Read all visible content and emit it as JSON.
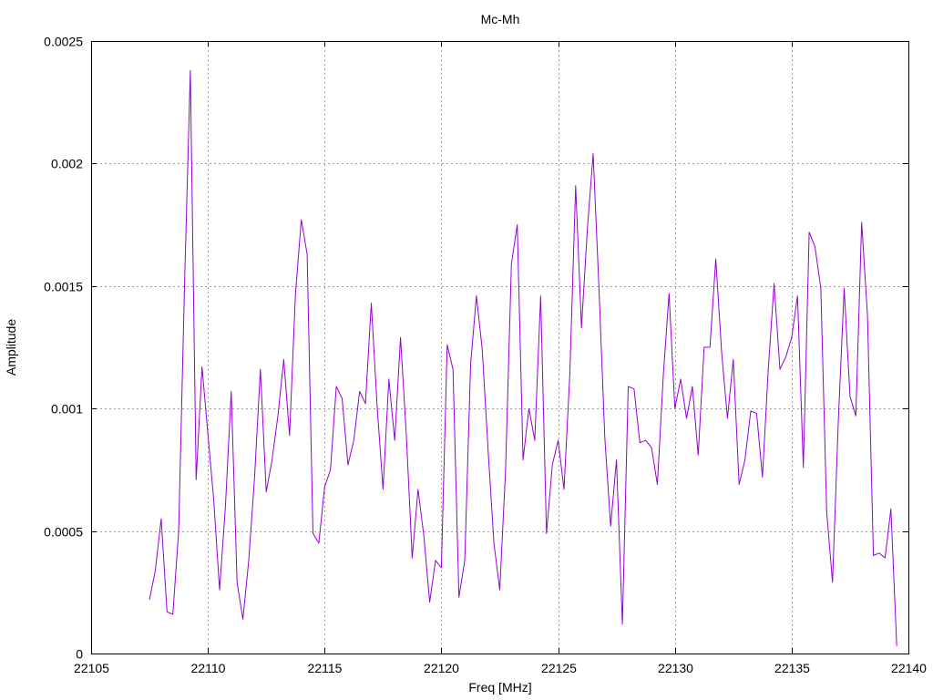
{
  "chart_data": {
    "type": "line",
    "title": "Mc-Mh",
    "xlabel": "Freq [MHz]",
    "ylabel": "Amplitude",
    "xlim": [
      22105,
      22140
    ],
    "ylim": [
      0,
      0.0025
    ],
    "xticks": [
      "22105",
      "22110",
      "22115",
      "22120",
      "22125",
      "22130",
      "22135",
      "22140"
    ],
    "yticks": [
      "0",
      "0.0005",
      "0.001",
      "0.0015",
      "0.002",
      "0.0025"
    ],
    "grid": true,
    "series": [
      {
        "color": "#9400d3",
        "x": [
          22107.5,
          22107.75,
          22108.0,
          22108.25,
          22108.5,
          22108.75,
          22109.0,
          22109.25,
          22109.5,
          22109.75,
          22110.0,
          22110.25,
          22110.5,
          22110.75,
          22111.0,
          22111.25,
          22111.5,
          22111.75,
          22112.0,
          22112.25,
          22112.5,
          22112.75,
          22113.0,
          22113.25,
          22113.5,
          22113.75,
          22114.0,
          22114.25,
          22114.5,
          22114.75,
          22115.0,
          22115.25,
          22115.5,
          22115.75,
          22116.0,
          22116.25,
          22116.5,
          22116.75,
          22117.0,
          22117.25,
          22117.5,
          22117.75,
          22118.0,
          22118.25,
          22118.5,
          22118.75,
          22119.0,
          22119.25,
          22119.5,
          22119.75,
          22120.0,
          22120.25,
          22120.5,
          22120.75,
          22121.0,
          22121.25,
          22121.5,
          22121.75,
          22122.0,
          22122.25,
          22122.5,
          22122.75,
          22123.0,
          22123.25,
          22123.5,
          22123.75,
          22124.0,
          22124.25,
          22124.5,
          22124.75,
          22125.0,
          22125.25,
          22125.5,
          22125.75,
          22126.0,
          22126.25,
          22126.5,
          22126.75,
          22127.0,
          22127.25,
          22127.5,
          22127.75,
          22128.0,
          22128.25,
          22128.5,
          22128.75,
          22129.0,
          22129.25,
          22129.5,
          22129.75,
          22130.0,
          22130.25,
          22130.5,
          22130.75,
          22131.0,
          22131.25,
          22131.5,
          22131.75,
          22132.0,
          22132.25,
          22132.5,
          22132.75,
          22133.0,
          22133.25,
          22133.5,
          22133.75,
          22134.0,
          22134.25,
          22134.5,
          22134.75,
          22135.0,
          22135.25,
          22135.5,
          22135.75,
          22136.0,
          22136.25,
          22136.5,
          22136.75,
          22137.0,
          22137.25,
          22137.5,
          22137.75,
          22138.0,
          22138.25,
          22138.5,
          22138.75,
          22139.0,
          22139.25,
          22139.5
        ],
        "y": [
          0.00022,
          0.00034,
          0.00055,
          0.00017,
          0.00016,
          0.0005,
          0.0015,
          0.00238,
          0.00071,
          0.00117,
          0.0009,
          0.00063,
          0.00026,
          0.0006,
          0.00107,
          0.00029,
          0.00014,
          0.00038,
          0.00072,
          0.00116,
          0.00066,
          0.00079,
          0.00097,
          0.0012,
          0.00089,
          0.00147,
          0.00177,
          0.00163,
          0.00049,
          0.00045,
          0.00068,
          0.00075,
          0.00109,
          0.00104,
          0.00077,
          0.00087,
          0.00107,
          0.00102,
          0.00143,
          0.00101,
          0.00067,
          0.00112,
          0.00087,
          0.00129,
          0.00089,
          0.00039,
          0.00067,
          0.00048,
          0.00021,
          0.00038,
          0.00035,
          0.00126,
          0.00116,
          0.00023,
          0.00038,
          0.00118,
          0.00146,
          0.00124,
          0.00083,
          0.00045,
          0.00026,
          0.00075,
          0.00159,
          0.00175,
          0.00079,
          0.001,
          0.00087,
          0.00146,
          0.00049,
          0.00077,
          0.00087,
          0.00067,
          0.00114,
          0.00191,
          0.00133,
          0.00173,
          0.00204,
          0.00149,
          0.00088,
          0.00052,
          0.00079,
          0.00012,
          0.00109,
          0.00108,
          0.00086,
          0.00087,
          0.00084,
          0.00069,
          0.00113,
          0.00147,
          0.001,
          0.00112,
          0.00096,
          0.00109,
          0.00081,
          0.00125,
          0.00125,
          0.00161,
          0.00123,
          0.00096,
          0.0012,
          0.00069,
          0.00079,
          0.00099,
          0.00098,
          0.00072,
          0.00116,
          0.00151,
          0.00116,
          0.00121,
          0.00129,
          0.00146,
          0.00076,
          0.00172,
          0.00166,
          0.00149,
          0.00058,
          0.00029,
          0.00095,
          0.00149,
          0.00105,
          0.00097,
          0.00176,
          0.00138,
          0.0004,
          0.00041,
          0.00039,
          0.00059,
          3e-05
        ]
      }
    ]
  }
}
